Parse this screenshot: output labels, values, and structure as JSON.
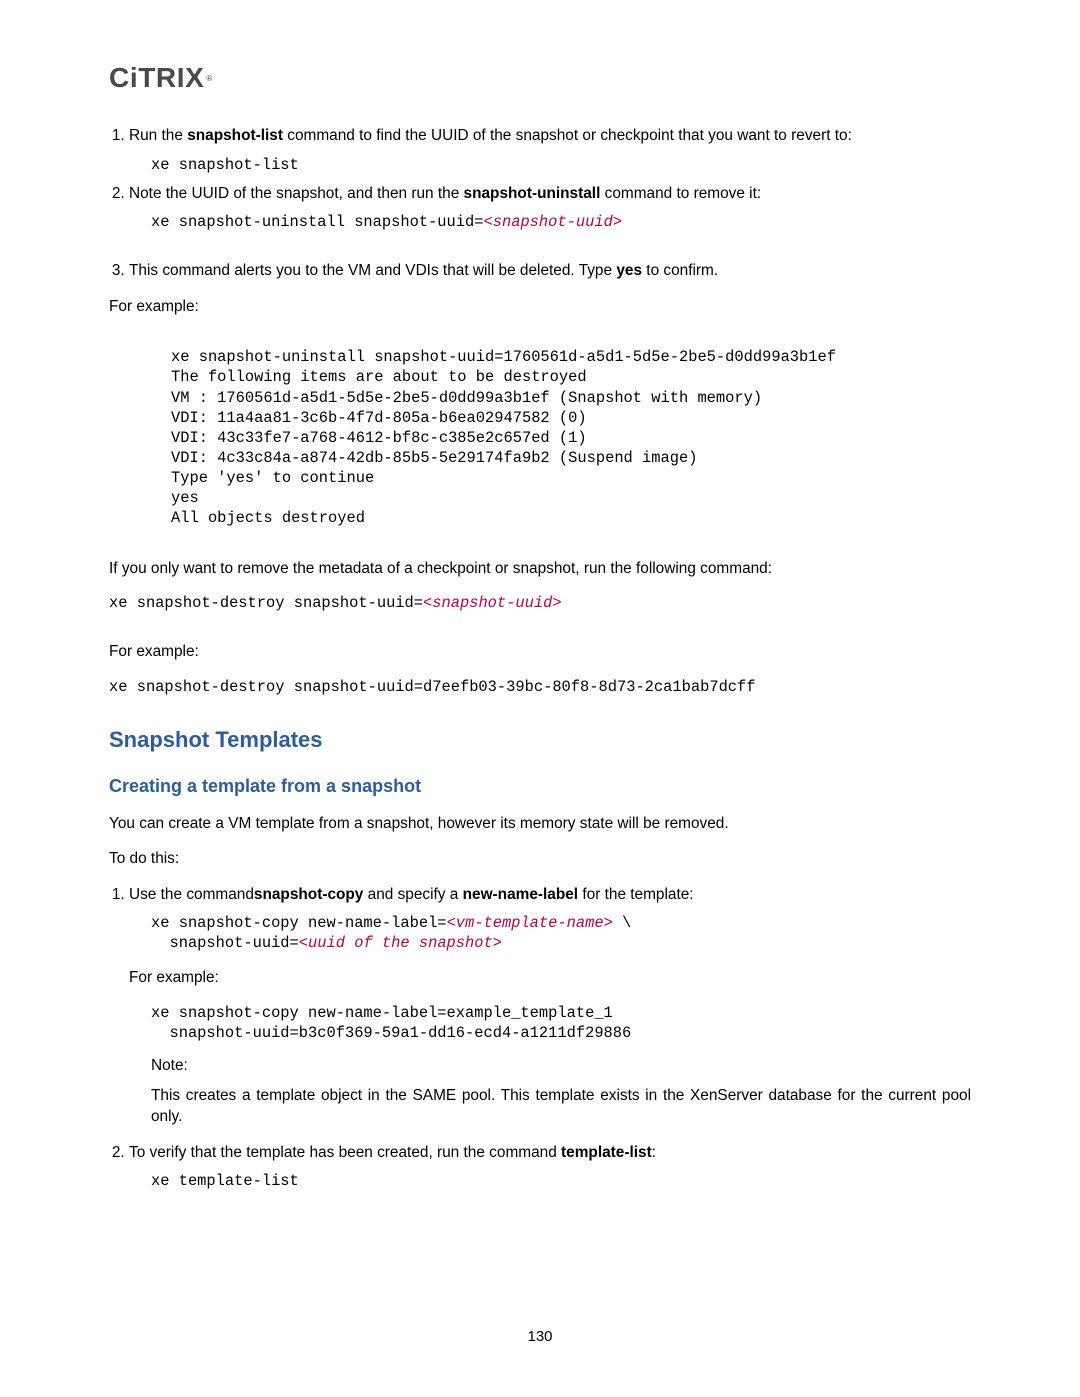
{
  "logo": "CITRIX",
  "step1_pre": "Run the ",
  "step1_cmd": "snapshot-list",
  "step1_post": " command to find the UUID of the snapshot or checkpoint that you want to revert to:",
  "code1": "xe snapshot-list",
  "step2_pre": "Note the UUID of the snapshot, and then run the ",
  "step2_cmd": "snapshot-uninstall",
  "step2_post": " command to remove it:",
  "code2_pre": "xe snapshot-uninstall snapshot-uuid=",
  "code2_arg": "<snapshot-uuid>",
  "step3_pre": "This command alerts you to the VM and VDIs that will be deleted. Type ",
  "step3_yes": "yes",
  "step3_post": " to confirm.",
  "for_example": "For example:",
  "big_example_l1": "xe snapshot-uninstall snapshot-uuid=1760561d-a5d1-5d5e-2be5-d0dd99a3b1ef",
  "big_example_l2": "The following items are about to be destroyed",
  "big_example_l3": "VM : 1760561d-a5d1-5d5e-2be5-d0dd99a3b1ef (Snapshot with memory)",
  "big_example_l4": "VDI: 11a4aa81-3c6b-4f7d-805a-b6ea02947582 (0)",
  "big_example_l5": "VDI: 43c33fe7-a768-4612-bf8c-c385e2c657ed (1)",
  "big_example_l6": "VDI: 4c33c84a-a874-42db-85b5-5e29174fa9b2 (Suspend image)",
  "big_example_l7": "Type 'yes' to continue",
  "big_example_l8": "yes",
  "big_example_l9": "All objects destroyed",
  "metadata_para": "If you only want to remove the metadata of a checkpoint or snapshot, run the following command:",
  "destroy_cmd_pre": "xe snapshot-destroy snapshot-uuid=",
  "destroy_cmd_arg": "<snapshot-uuid>",
  "destroy_example": "xe snapshot-destroy snapshot-uuid=d7eefb03-39bc-80f8-8d73-2ca1bab7dcff",
  "h2": "Snapshot Templates",
  "h3": "Creating a template from a snapshot",
  "template_intro": "You can create a VM template from a snapshot, however its memory state will be removed.",
  "to_do_this": "To do this:",
  "t_step1_a": "Use the command",
  "t_step1_b": "snapshot-copy",
  "t_step1_c": "  and specify a ",
  "t_step1_d": "new-name-label",
  "t_step1_e": " for the template:",
  "copy_code1_pre": "xe snapshot-copy new-name-label=",
  "copy_code1_arg1": "<vm-template-name>",
  "copy_code1_back": " \\",
  "copy_code2_pre": "  snapshot-uuid=",
  "copy_code2_arg": "<uuid of the snapshot>",
  "copy_ex_l1": "xe snapshot-copy new-name-label=example_template_1",
  "copy_ex_l2": "  snapshot-uuid=b3c0f369-59a1-dd16-ecd4-a1211df29886",
  "note_label": "Note:",
  "note_body": "This creates a template object in the SAME pool. This template exists in the XenServer database for the current pool only.",
  "t_step2_a": "To verify that the template has been created, run the command ",
  "t_step2_b": "template-list",
  "t_step2_c": ":",
  "tlist_code": "xe template-list",
  "page_number": "130"
}
